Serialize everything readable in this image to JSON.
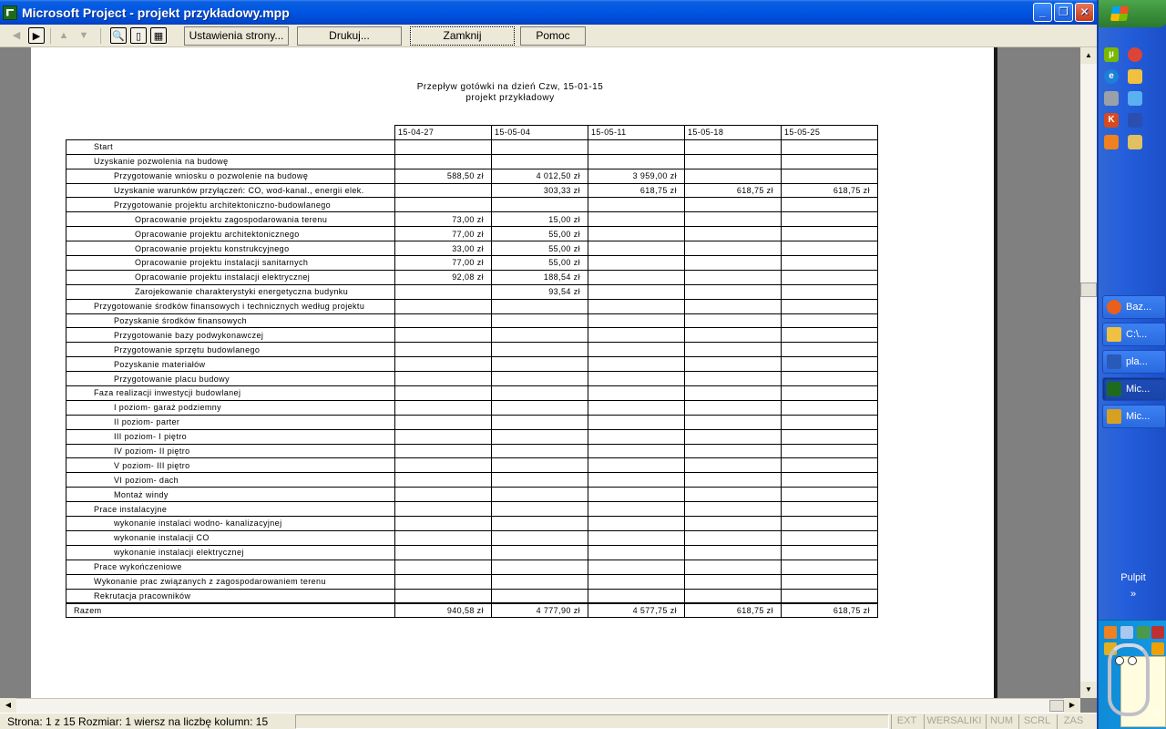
{
  "window": {
    "title": "Microsoft Project - projekt przykładowy.mpp",
    "min_glyph": "_",
    "restore_glyph": "❐",
    "close_glyph": "✕"
  },
  "toolbar": {
    "prev_glyph": "◀",
    "next_glyph": "▶",
    "up_glyph": "▲",
    "down_glyph": "▼",
    "zoom_glyph": "🔍",
    "one_page_glyph": "▯",
    "multi_page_glyph": "▦",
    "page_setup_label": "Ustawienia strony...",
    "print_label": "Drukuj...",
    "close_label": "Zamknij",
    "help_label": "Pomoc"
  },
  "report": {
    "title": "Przepływ gotówki na dzień Czw, 15-01-15",
    "subtitle": "projekt przykładowy",
    "dates": [
      "15-04-27",
      "15-05-04",
      "15-05-11",
      "15-05-18",
      "15-05-25"
    ],
    "rows": [
      {
        "level": 0,
        "name": "Start",
        "values": [
          "",
          "",
          "",
          "",
          ""
        ]
      },
      {
        "level": 0,
        "name": "Uzyskanie pozwolenia na budowę",
        "values": [
          "",
          "",
          "",
          "",
          ""
        ]
      },
      {
        "level": 1,
        "name": "Przygotowanie wniosku o pozwolenie na budowę",
        "values": [
          "588,50 zł",
          "4 012,50 zł",
          "3 959,00 zł",
          "",
          ""
        ]
      },
      {
        "level": 1,
        "name": "Uzyskanie warunków przyłączeń: CO, wod-kanal., energii elek.",
        "values": [
          "",
          "303,33 zł",
          "618,75 zł",
          "618,75 zł",
          "618,75 zł"
        ]
      },
      {
        "level": 1,
        "name": "Przygotowanie projektu architektoniczno-budowlanego",
        "values": [
          "",
          "",
          "",
          "",
          ""
        ]
      },
      {
        "level": 2,
        "name": "Opracowanie projektu zagospodarowania terenu",
        "values": [
          "73,00 zł",
          "15,00 zł",
          "",
          "",
          ""
        ]
      },
      {
        "level": 2,
        "name": "Opracowanie projektu architektonicznego",
        "values": [
          "77,00 zł",
          "55,00 zł",
          "",
          "",
          ""
        ]
      },
      {
        "level": 2,
        "name": "Opracowanie projektu konstrukcyjnego",
        "values": [
          "33,00 zł",
          "55,00 zł",
          "",
          "",
          ""
        ]
      },
      {
        "level": 2,
        "name": "Opracowanie projektu instalacji sanitarnych",
        "values": [
          "77,00 zł",
          "55,00 zł",
          "",
          "",
          ""
        ]
      },
      {
        "level": 2,
        "name": "Opracowanie projektu instalacji elektrycznej",
        "values": [
          "92,08 zł",
          "188,54 zł",
          "",
          "",
          ""
        ]
      },
      {
        "level": 2,
        "name": "Zarojekowanie charakterystyki energetyczna budynku",
        "values": [
          "",
          "93,54 zł",
          "",
          "",
          ""
        ]
      },
      {
        "level": 0,
        "name": "Przygotowanie środków finansowych i technicznych według projektu",
        "values": [
          "",
          "",
          "",
          "",
          ""
        ]
      },
      {
        "level": 1,
        "name": "Pozyskanie środków finansowych",
        "values": [
          "",
          "",
          "",
          "",
          ""
        ]
      },
      {
        "level": 1,
        "name": "Przygotowanie bazy podwykonawczej",
        "values": [
          "",
          "",
          "",
          "",
          ""
        ]
      },
      {
        "level": 1,
        "name": "Przygotowanie sprzętu budowlanego",
        "values": [
          "",
          "",
          "",
          "",
          ""
        ]
      },
      {
        "level": 1,
        "name": "Pozyskanie materiałów",
        "values": [
          "",
          "",
          "",
          "",
          ""
        ]
      },
      {
        "level": 1,
        "name": "Przygotowanie placu budowy",
        "values": [
          "",
          "",
          "",
          "",
          ""
        ]
      },
      {
        "level": 0,
        "name": "Faza realizacji inwestycji budowlanej",
        "values": [
          "",
          "",
          "",
          "",
          ""
        ]
      },
      {
        "level": 1,
        "name": "I poziom- garaż podziemny",
        "values": [
          "",
          "",
          "",
          "",
          ""
        ]
      },
      {
        "level": 1,
        "name": "II poziom- parter",
        "values": [
          "",
          "",
          "",
          "",
          ""
        ]
      },
      {
        "level": 1,
        "name": "III poziom- I piętro",
        "values": [
          "",
          "",
          "",
          "",
          ""
        ]
      },
      {
        "level": 1,
        "name": "IV poziom- II piętro",
        "values": [
          "",
          "",
          "",
          "",
          ""
        ]
      },
      {
        "level": 1,
        "name": "V poziom- III piętro",
        "values": [
          "",
          "",
          "",
          "",
          ""
        ]
      },
      {
        "level": 1,
        "name": "VI poziom- dach",
        "values": [
          "",
          "",
          "",
          "",
          ""
        ]
      },
      {
        "level": 1,
        "name": "Montaż windy",
        "values": [
          "",
          "",
          "",
          "",
          ""
        ]
      },
      {
        "level": 0,
        "name": "Prace instalacyjne",
        "values": [
          "",
          "",
          "",
          "",
          ""
        ]
      },
      {
        "level": 1,
        "name": "wykonanie instalaci wodno- kanalizacyjnej",
        "values": [
          "",
          "",
          "",
          "",
          ""
        ]
      },
      {
        "level": 1,
        "name": "wykonanie instalacji CO",
        "values": [
          "",
          "",
          "",
          "",
          ""
        ]
      },
      {
        "level": 1,
        "name": "wykonanie instalacji elektrycznej",
        "values": [
          "",
          "",
          "",
          "",
          ""
        ]
      },
      {
        "level": 0,
        "name": "Prace wykończeniowe",
        "values": [
          "",
          "",
          "",
          "",
          ""
        ]
      },
      {
        "level": 0,
        "name": "Wykonanie prac związanych z zagospodarowaniem terenu",
        "values": [
          "",
          "",
          "",
          "",
          ""
        ]
      },
      {
        "level": 0,
        "name": "Rekrutacja pracowników",
        "values": [
          "",
          "",
          "",
          "",
          ""
        ]
      }
    ],
    "total": {
      "label": "Razem",
      "values": [
        "940,58 zł",
        "4 777,90 zł",
        "4 577,75 zł",
        "618,75 zł",
        "618,75 zł"
      ]
    }
  },
  "status": {
    "text": "Strona: 1 z 15   Rozmiar: 1 wiersz na liczbę kolumn: 15",
    "indicators": [
      "EXT",
      "WERSALIKI",
      "NUM",
      "SCRL",
      "ZAS"
    ]
  },
  "scroll": {
    "up_glyph": "▲",
    "down_glyph": "▼",
    "left_glyph": "◀",
    "right_glyph": "▶"
  },
  "taskbar": {
    "items": [
      {
        "label": "Baz...",
        "color": "#e8601c"
      },
      {
        "label": "C:\\...",
        "color": "#f0c040"
      },
      {
        "label": "pla...",
        "color": "#2a5ab8"
      },
      {
        "label": "Mic...",
        "color": "#1e6b1e"
      },
      {
        "label": "Mic...",
        "color": "#d8a020"
      }
    ],
    "desktop_label": "Pulpit",
    "desktop_chevron": "»",
    "clock_text": "5"
  }
}
